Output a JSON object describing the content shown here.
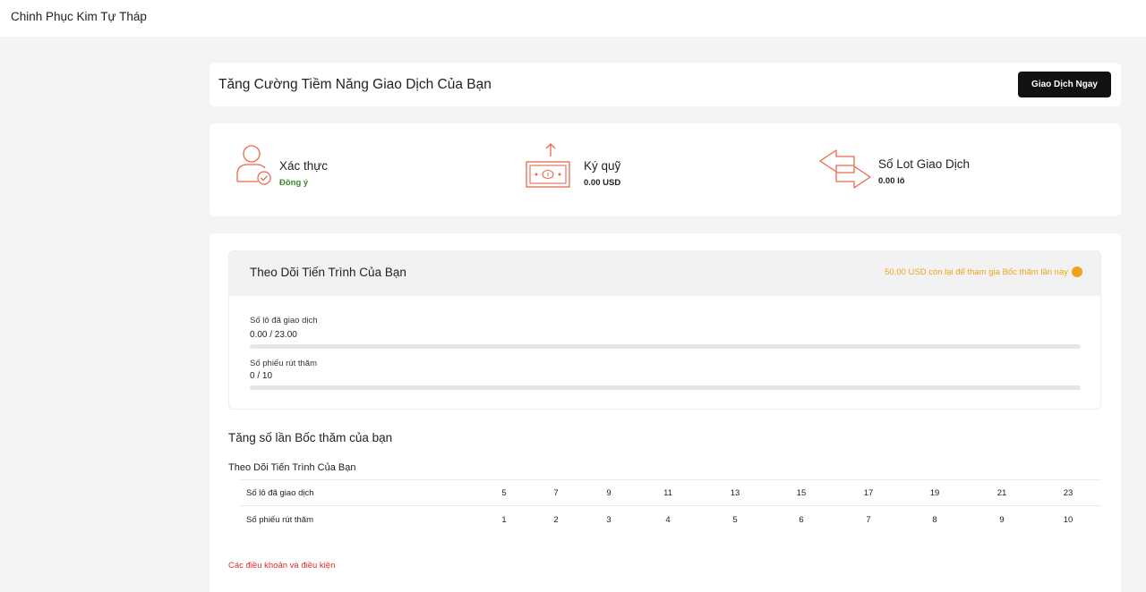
{
  "app": {
    "title": "Chinh Phục Kim Tự Tháp"
  },
  "hero": {
    "title": "Tăng Cường Tiềm Năng Giao Dịch Của Bạn",
    "button_label": "Giao Dịch Ngay"
  },
  "stats": [
    {
      "label": "Xác thực",
      "value": "Đồng ý",
      "icon": "user-check-icon"
    },
    {
      "label": "Ký quỹ",
      "value": "0.00 USD",
      "icon": "money-deposit-icon"
    },
    {
      "label": "Số Lot Giao Dịch",
      "value": "0.00 lô",
      "icon": "exchange-arrows-icon"
    }
  ],
  "progress": {
    "title": "Theo Dõi Tiến Trình Của Bạn",
    "notice": "50.00 USD còn lại để tham gia Bốc thăm lần này",
    "items": [
      {
        "label": "Số lô đã giao dịch",
        "value": "0.00 / 23.00",
        "fraction": 0
      },
      {
        "label": "Số phiếu rút thăm",
        "value": "0 / 10",
        "fraction": 0
      }
    ]
  },
  "boost": {
    "title": "Tăng số lần Bốc thăm của bạn",
    "subtitle": "Theo Dõi Tiến Trình Của Bạn",
    "rows": [
      {
        "label": "Số lô đã giao dịch",
        "values": [
          "5",
          "7",
          "9",
          "11",
          "13",
          "15",
          "17",
          "19",
          "21",
          "23"
        ]
      },
      {
        "label": "Số phiếu rút thăm",
        "values": [
          "1",
          "2",
          "3",
          "4",
          "5",
          "6",
          "7",
          "8",
          "9",
          "10"
        ]
      }
    ]
  },
  "terms_link": "Các điều khoản và điều kiện",
  "colors": {
    "accent": "#e8694d",
    "notice": "#f0a21c",
    "success": "#3a8a2a",
    "link": "#e02b2b",
    "button": "#111111"
  }
}
